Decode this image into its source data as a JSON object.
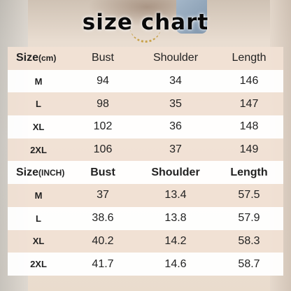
{
  "title": "size chart",
  "tables": [
    {
      "size_label": "Size",
      "unit": "(cm)",
      "columns": [
        "Bust",
        "Shoulder",
        "Length"
      ],
      "rows": [
        {
          "size": "M",
          "values": [
            "94",
            "34",
            "146"
          ]
        },
        {
          "size": "L",
          "values": [
            "98",
            "35",
            "147"
          ]
        },
        {
          "size": "XL",
          "values": [
            "102",
            "36",
            "148"
          ]
        },
        {
          "size": "2XL",
          "values": [
            "106",
            "37",
            "149"
          ]
        }
      ]
    },
    {
      "size_label": "Size",
      "unit": "(INCH)",
      "columns": [
        "Bust",
        "Shoulder",
        "Length"
      ],
      "rows": [
        {
          "size": "M",
          "values": [
            "37",
            "13.4",
            "57.5"
          ]
        },
        {
          "size": "L",
          "values": [
            "38.6",
            "13.8",
            "57.9"
          ]
        },
        {
          "size": "XL",
          "values": [
            "40.2",
            "14.2",
            "58.3"
          ]
        },
        {
          "size": "2XL",
          "values": [
            "41.7",
            "14.6",
            "58.7"
          ]
        }
      ]
    }
  ]
}
